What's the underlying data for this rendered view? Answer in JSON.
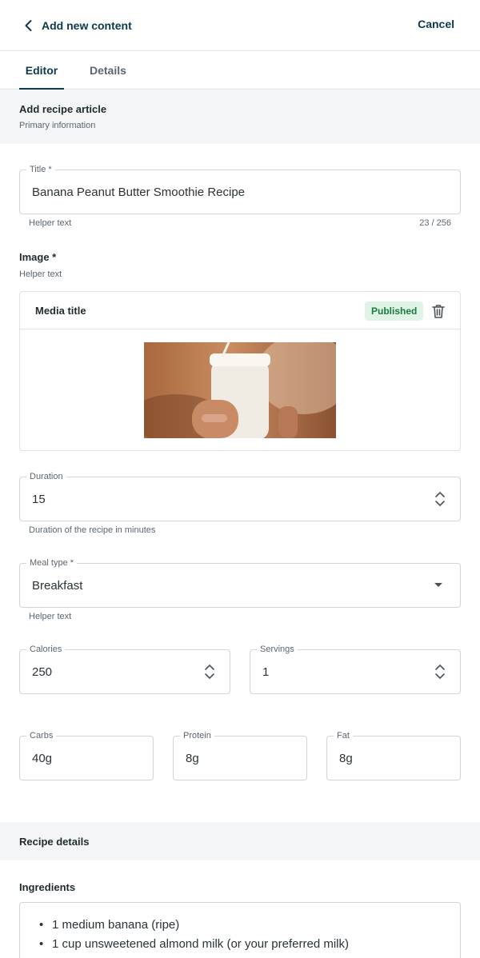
{
  "header": {
    "back_label": "Add new content",
    "cancel_label": "Cancel"
  },
  "tabs": [
    {
      "label": "Editor",
      "active": true
    },
    {
      "label": "Details",
      "active": false
    }
  ],
  "section_primary": {
    "title": "Add recipe article",
    "subtitle": "Primary information"
  },
  "title_field": {
    "label": "Title *",
    "value": "Banana Peanut Butter Smoothie Recipe",
    "helper": "Helper text",
    "counter": "23 / 256"
  },
  "image_field": {
    "label": "Image *",
    "helper": "Helper text",
    "media_title": "Media title",
    "status": "Published"
  },
  "duration": {
    "label": "Duration",
    "value": "15",
    "helper": "Duration of the recipe in minutes"
  },
  "meal_type": {
    "label": "Meal type *",
    "value": "Breakfast",
    "helper": "Helper text"
  },
  "calories": {
    "label": "Calories",
    "value": "250"
  },
  "servings": {
    "label": "Servings",
    "value": "1"
  },
  "carbs": {
    "label": "Carbs",
    "value": "40g"
  },
  "protein": {
    "label": "Protein",
    "value": "8g"
  },
  "fat": {
    "label": "Fat",
    "value": "8g"
  },
  "section_details": {
    "title": "Recipe details"
  },
  "ingredients": {
    "label": "Ingredients",
    "items": [
      "1 medium banana (ripe)",
      "1 cup unsweetened almond milk (or your preferred milk)"
    ]
  },
  "colors": {
    "accent": "#0b3b4a",
    "badge_bg": "#dff3e6",
    "badge_text": "#1c7a3f",
    "section_bg": "#f3f5f6"
  }
}
